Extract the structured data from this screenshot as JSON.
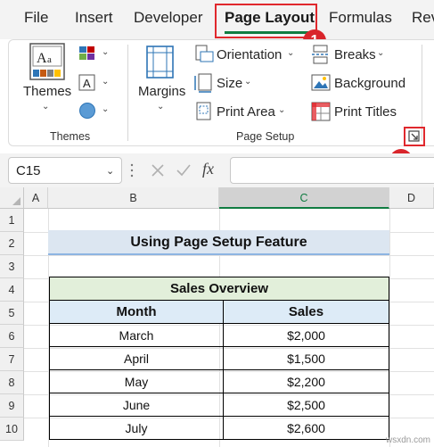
{
  "tabs": [
    "File",
    "Insert",
    "Developer",
    "Page Layout",
    "Formulas",
    "Rev"
  ],
  "active_tab": "Page Layout",
  "badges": {
    "first": "1",
    "second": "2"
  },
  "ribbon": {
    "themes_group": {
      "themes_label": "Themes",
      "group_label": "Themes"
    },
    "page_setup_group": {
      "margins_label": "Margins",
      "orientation_label": "Orientation",
      "size_label": "Size",
      "print_area_label": "Print Area",
      "breaks_label": "Breaks",
      "background_label": "Background",
      "print_titles_label": "Print Titles",
      "group_label": "Page Setup"
    }
  },
  "formula_bar": {
    "name_box_value": "C15",
    "fx_symbol": "fx",
    "formula_value": ""
  },
  "sheet": {
    "columns": [
      "A",
      "B",
      "C",
      "D"
    ],
    "selected_column": "C",
    "rows": [
      "1",
      "2",
      "3",
      "4",
      "5",
      "6",
      "7",
      "8",
      "9",
      "10"
    ],
    "title": "Using Page Setup Feature",
    "table": {
      "caption": "Sales Overview",
      "headers": [
        "Month",
        "Sales"
      ],
      "rows": [
        [
          "March",
          "$2,000"
        ],
        [
          "April",
          "$1,500"
        ],
        [
          "May",
          "$2,200"
        ],
        [
          "June",
          "$2,500"
        ],
        [
          "July",
          "$2,600"
        ]
      ]
    }
  },
  "watermark": "wsxdn.com"
}
